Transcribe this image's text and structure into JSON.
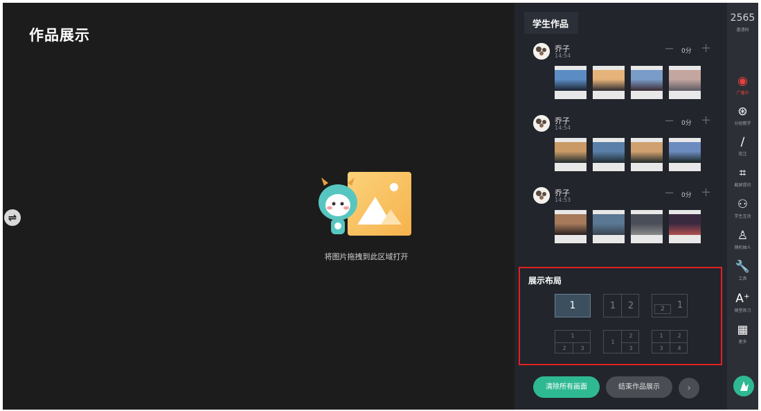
{
  "page": {
    "title": "作品展示",
    "drop_hint": "将图片拖拽到此区域打开"
  },
  "panel": {
    "tab": "学生作品",
    "students": [
      {
        "name": "乔子",
        "time": "14:54",
        "score": "0分",
        "thumbs": [
          [
            "#5c8dc4",
            "#1a2230"
          ],
          [
            "#e6b47a",
            "#2a2a30"
          ],
          [
            "#7a9cc9",
            "#3a2a30"
          ],
          [
            "#c4a6a0",
            "#5a5a62"
          ]
        ]
      },
      {
        "name": "乔子",
        "time": "14:54",
        "score": "0分",
        "thumbs": [
          [
            "#c99a66",
            "#1e2a2e"
          ],
          [
            "#5a7fa8",
            "#1f2a30"
          ],
          [
            "#d0a070",
            "#202a2a"
          ],
          [
            "#6c8cc0",
            "#1a2420"
          ]
        ]
      },
      {
        "name": "乔子",
        "time": "14:53",
        "score": "0分",
        "thumbs": [
          [
            "#a67a5a",
            "#2a2020"
          ],
          [
            "#5a7894",
            "#3a4450"
          ],
          [
            "#4a4e58",
            "#8a8a8a"
          ],
          [
            "#3a2a40",
            "#b05050"
          ]
        ]
      }
    ],
    "layout": {
      "title": "展示布局",
      "options": [
        {
          "cells": [
            "1"
          ]
        },
        {
          "cells": [
            "1",
            "2"
          ]
        },
        {
          "cells": [
            "2",
            "1"
          ]
        },
        {
          "cells": [
            "1",
            "2",
            "3"
          ]
        },
        {
          "cells": [
            "1",
            "2",
            "3"
          ]
        },
        {
          "cells": [
            "1",
            "2",
            "3",
            "4"
          ]
        }
      ]
    },
    "buttons": {
      "clear": "清除所有画面",
      "end": "结束作品展示",
      "next_icon": "chevron-right-icon"
    }
  },
  "toolbar": {
    "code": "2565",
    "code_label": "邀请码",
    "tools": [
      {
        "label": "广播中",
        "icon": "broadcast-icon",
        "glyph": "◉"
      },
      {
        "label": "分组教学",
        "icon": "group-teaching-icon",
        "glyph": "⊛"
      },
      {
        "label": "批注",
        "icon": "annotate-pen-icon",
        "glyph": "∕"
      },
      {
        "label": "截屏提问",
        "icon": "crop-icon",
        "glyph": "⌗"
      },
      {
        "label": "学生互动",
        "icon": "interaction-icon",
        "glyph": "⚇"
      },
      {
        "label": "随机抽人",
        "icon": "random-person-icon",
        "glyph": "♙"
      },
      {
        "label": "工具",
        "icon": "wrench-icon",
        "glyph": "🔧"
      },
      {
        "label": "随堂练习",
        "icon": "practice-icon",
        "glyph": "A⁺"
      },
      {
        "label": "更多",
        "icon": "grid-more-icon",
        "glyph": "▦"
      }
    ],
    "accent": "#2fb993",
    "live_color": "#e8403a"
  }
}
